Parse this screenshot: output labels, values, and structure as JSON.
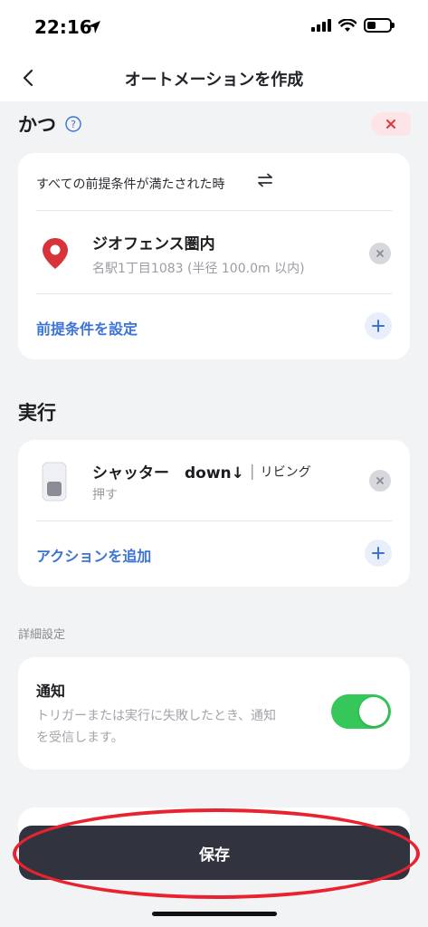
{
  "status_bar": {
    "time": "22:16"
  },
  "header": {
    "title": "オートメーションを作成"
  },
  "condition_section": {
    "title": "かつ",
    "card_heading": "すべての前提条件が満たされた時",
    "item": {
      "title": "ジオフェンス圏内",
      "subtitle": "名駅1丁目1083 (半径 100.0m 以内)"
    },
    "add_label": "前提条件を設定"
  },
  "action_section": {
    "title": "実行",
    "item": {
      "title": "シャッター　down↓",
      "room": "リビング",
      "subtitle": "押す"
    },
    "add_label": "アクションを追加"
  },
  "details": {
    "label": "詳細設定",
    "notification": {
      "title": "通知",
      "description_line1": "トリガーまたは実行に失敗したとき、通知",
      "description_line2": "を受信します。",
      "enabled": true
    }
  },
  "save_button": {
    "label": "保存"
  },
  "colors": {
    "accent_blue": "#3b73d6",
    "save_button_bg": "#31343f",
    "toggle_on": "#35c759",
    "delete_red": "#e2333f",
    "highlight_red": "#e8232f"
  },
  "icons": {
    "location": "location-pin-icon",
    "device": "switch-device-icon",
    "help": "help-icon",
    "swap": "swap-icon"
  }
}
